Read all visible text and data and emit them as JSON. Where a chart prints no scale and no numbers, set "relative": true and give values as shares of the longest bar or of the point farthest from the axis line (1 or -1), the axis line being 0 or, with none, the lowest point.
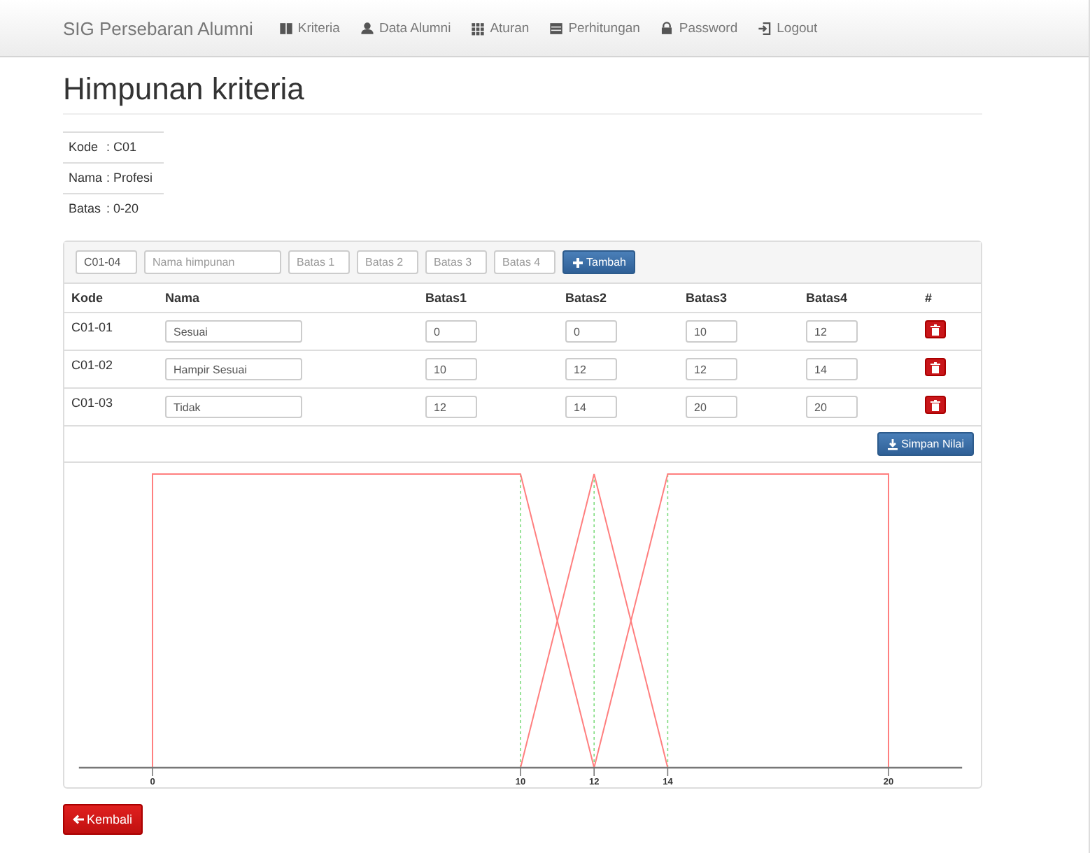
{
  "navbar": {
    "brand": "SIG Persebaran Alumni",
    "items": [
      {
        "label": "Kriteria"
      },
      {
        "label": "Data Alumni"
      },
      {
        "label": "Aturan"
      },
      {
        "label": "Perhitungan"
      },
      {
        "label": "Password"
      },
      {
        "label": "Logout"
      }
    ]
  },
  "title": "Himpunan kriteria",
  "info": [
    {
      "label": "Kode",
      "value": ": C01"
    },
    {
      "label": "Nama",
      "value": ": Profesi"
    },
    {
      "label": "Batas",
      "value": ": 0-20"
    }
  ],
  "add_form": {
    "code_value": "C01-04",
    "fields": [
      {
        "placeholder": "Nama himpunan"
      },
      {
        "placeholder": "Batas 1"
      },
      {
        "placeholder": "Batas 2"
      },
      {
        "placeholder": "Batas 3"
      },
      {
        "placeholder": "Batas 4"
      }
    ],
    "button": "Tambah"
  },
  "table": {
    "columns": [
      "Kode",
      "Nama",
      "Batas1",
      "Batas2",
      "Batas3",
      "Batas4",
      "#"
    ],
    "rows": [
      {
        "code": "C01-01",
        "name": "Sesuai",
        "limits": [
          "0",
          "0",
          "10",
          "12"
        ]
      },
      {
        "code": "C01-02",
        "name": "Hampir Sesuai",
        "limits": [
          "10",
          "12",
          "12",
          "14"
        ]
      },
      {
        "code": "C01-03",
        "name": "Tidak",
        "limits": [
          "12",
          "14",
          "20",
          "20"
        ]
      }
    ]
  },
  "save_button": "Simpan Nilai",
  "chart_data": {
    "type": "line",
    "relative": true,
    "grid": true,
    "x": [
      0,
      0,
      10,
      12,
      14,
      20,
      20
    ],
    "xticks": [
      0,
      10,
      12,
      14,
      20
    ],
    "xlim": [
      -2,
      22
    ],
    "ylim": [
      0,
      1
    ],
    "series": [
      {
        "color": "#ff7f7f",
        "values": [
          0,
          1,
          1,
          0,
          null,
          null,
          null
        ]
      },
      {
        "color": "#ff7f7f",
        "values": [
          null,
          null,
          0,
          1,
          0,
          null,
          null
        ]
      },
      {
        "color": "#ff7f7f",
        "values": [
          null,
          null,
          null,
          0,
          1,
          1,
          0
        ]
      }
    ]
  },
  "back_button": "Kembali"
}
